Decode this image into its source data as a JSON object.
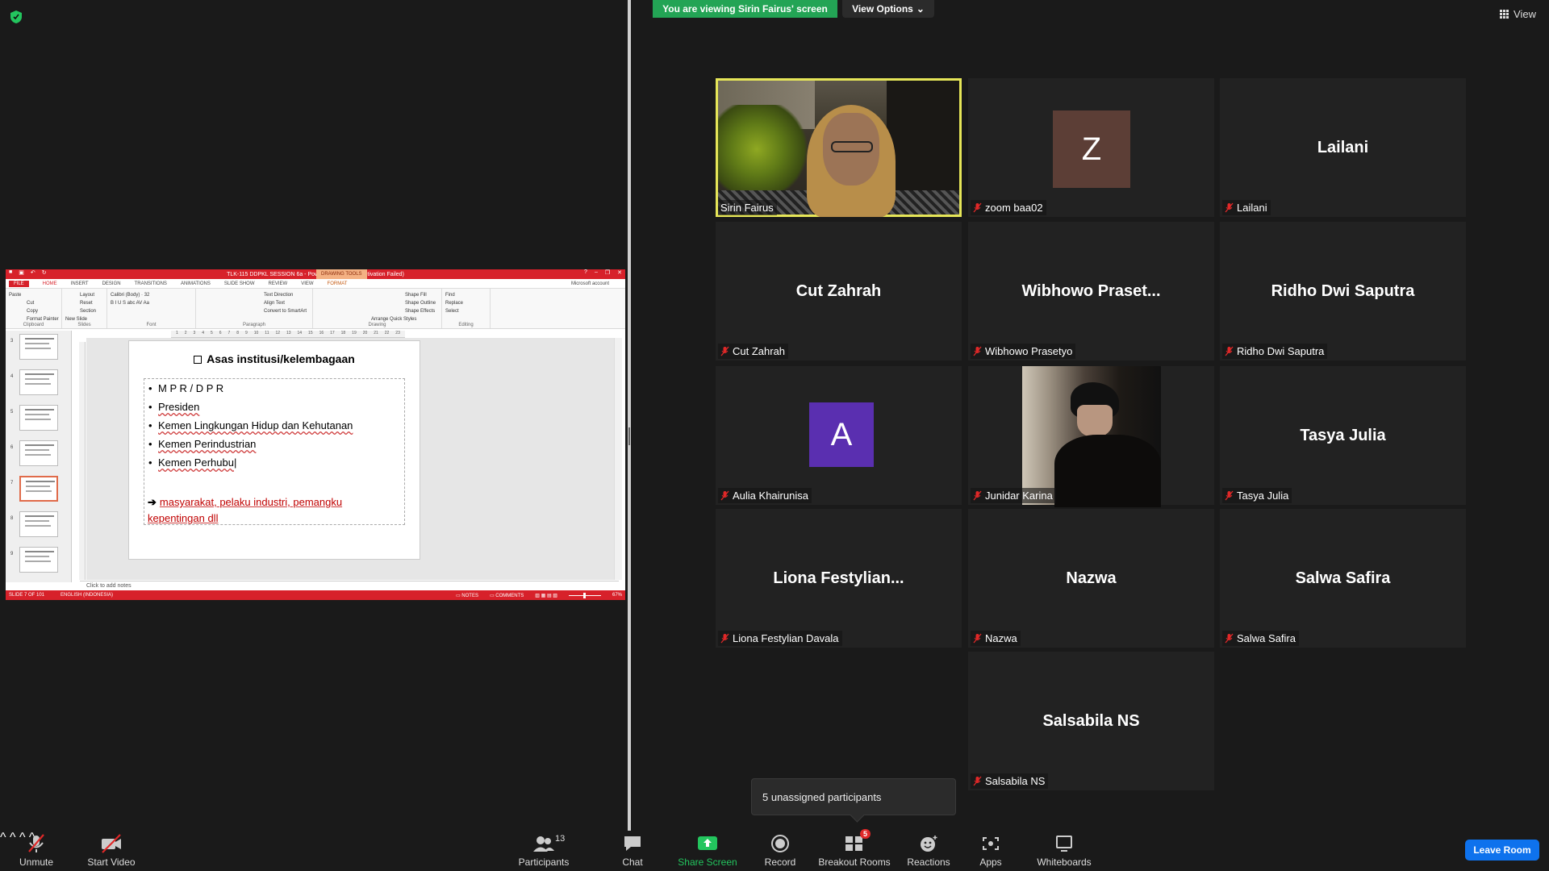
{
  "top": {
    "viewing_banner": "You are viewing Sirin Fairus' screen",
    "view_options": "View Options",
    "view_label": "View"
  },
  "ppt": {
    "title": "TLK-115 DDPKL SESSION 6a  -  PowerPoint (Product Activation Failed)",
    "drawing_tools": "DRAWING TOOLS",
    "tabs": [
      "FILE",
      "HOME",
      "INSERT",
      "DESIGN",
      "TRANSITIONS",
      "ANIMATIONS",
      "SLIDE SHOW",
      "REVIEW",
      "VIEW",
      "FORMAT"
    ],
    "account": "Microsoft account",
    "ribbon": {
      "clipboard": {
        "label": "Clipboard",
        "paste": "Paste",
        "cut": "Cut",
        "copy": "Copy",
        "format_painter": "Format Painter"
      },
      "slides": {
        "label": "Slides",
        "new_slide": "New Slide",
        "layout": "Layout",
        "reset": "Reset",
        "section": "Section"
      },
      "font": {
        "label": "Font",
        "name": "Calibri (Body)",
        "size": "32"
      },
      "paragraph": {
        "label": "Paragraph",
        "text_direction": "Text Direction",
        "align_text": "Align Text",
        "convert": "Convert to SmartArt"
      },
      "drawing": {
        "label": "Drawing",
        "arrange": "Arrange",
        "quick_styles": "Quick Styles",
        "shape_fill": "Shape Fill",
        "shape_outline": "Shape Outline",
        "shape_effects": "Shape Effects"
      },
      "editing": {
        "label": "Editing",
        "find": "Find",
        "replace": "Replace",
        "select": "Select"
      }
    },
    "ruler_ticks": [
      "1",
      "2",
      "3",
      "4",
      "5",
      "6",
      "7",
      "8",
      "9",
      "10",
      "11",
      "12",
      "13",
      "14",
      "15",
      "16",
      "17",
      "18",
      "19",
      "20",
      "21",
      "22",
      "23"
    ],
    "thumb_numbers": [
      "3",
      "4",
      "5",
      "6",
      "7",
      "8",
      "9"
    ],
    "slide": {
      "title": "Asas institusi/kelembagaan",
      "bullets": [
        "M P R / D P R",
        "Presiden",
        "Kemen Lingkungan Hidup dan Kehutanan",
        "Kemen Perindustrian",
        "Kemen Perhubu"
      ],
      "arrow_line1": "masyarakat, pelaku industri, pemangku",
      "arrow_line2": "kepentingan dll"
    },
    "notes": "Click to add notes",
    "status": {
      "slide": "SLIDE 7 OF 101",
      "language": "ENGLISH (INDONESIA)",
      "notes": "NOTES",
      "comments": "COMMENTS",
      "zoom": "67%"
    }
  },
  "participants_tiles": [
    {
      "big": "",
      "label": "Sirin Fairus"
    },
    {
      "big": "Z",
      "label": "zoom baa02",
      "avatar_color": "#5c3e36"
    },
    {
      "big": "Lailani",
      "label": "Lailani"
    },
    {
      "big": "Cut Zahrah",
      "label": "Cut Zahrah"
    },
    {
      "big": "Wibhowo  Praset...",
      "label": "Wibhowo Prasetyo"
    },
    {
      "big": "Ridho Dwi Saputra",
      "label": "Ridho Dwi Saputra"
    },
    {
      "big": "A",
      "label": "Aulia Khairunisa",
      "avatar_color": "#5a2fb0"
    },
    {
      "big": "",
      "label": "Junidar Karina"
    },
    {
      "big": "Tasya Julia",
      "label": "Tasya Julia"
    },
    {
      "big": "Liona  Festylian...",
      "label": "Liona Festylian Davala"
    },
    {
      "big": "Nazwa",
      "label": "Nazwa"
    },
    {
      "big": "Salwa Safira",
      "label": "Salwa Safira"
    },
    {
      "big": "Salsabila NS",
      "label": "Salsabila NS"
    }
  ],
  "unassigned": "5 unassigned participants",
  "toolbar": {
    "unmute": "Unmute",
    "start_video": "Start Video",
    "participants": "Participants",
    "participants_count": "13",
    "chat": "Chat",
    "share_screen": "Share Screen",
    "record": "Record",
    "breakout_rooms": "Breakout Rooms",
    "breakout_badge": "5",
    "reactions": "Reactions",
    "apps": "Apps",
    "whiteboards": "Whiteboards",
    "leave": "Leave Room"
  },
  "colors": {
    "banner_green": "#23a455",
    "leave_blue": "#0e72ed",
    "active_speaker": "#e6e658",
    "ppt_red": "#d7212a"
  }
}
